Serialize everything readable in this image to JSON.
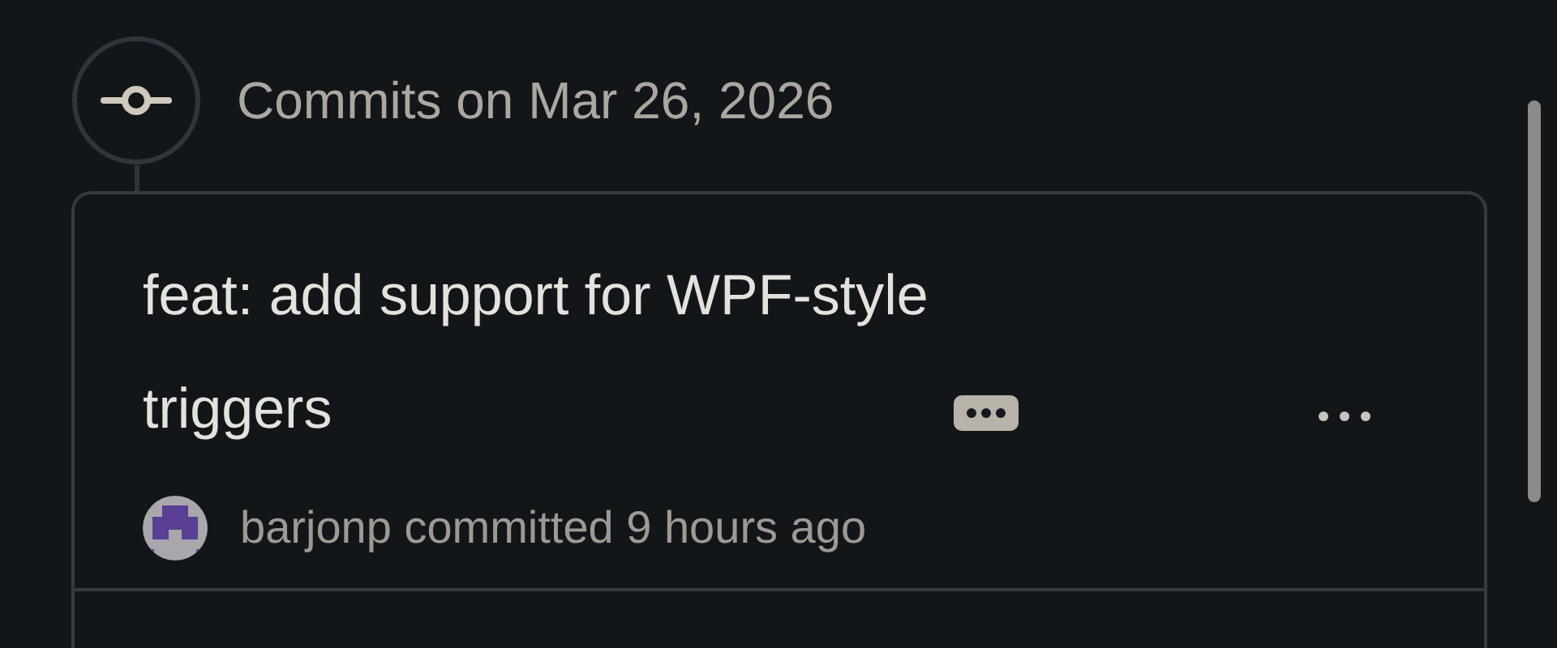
{
  "timeline": {
    "heading": "Commits on Mar 26, 2026"
  },
  "commits": [
    {
      "message": "feat: add support for WPF-style triggers",
      "author": "barjonp",
      "action": "committed",
      "time": "9 hours ago"
    }
  ]
}
